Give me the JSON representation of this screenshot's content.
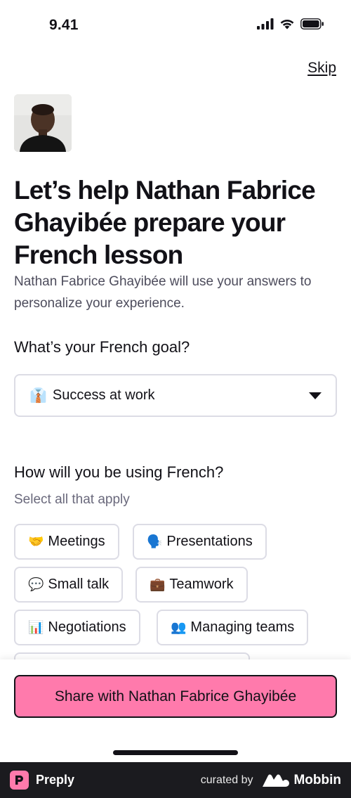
{
  "status_bar": {
    "time": "9.41"
  },
  "header": {
    "skip_label": "Skip"
  },
  "headline": "Let’s help Nathan Fabrice Ghayibée prepare your French lesson",
  "subtext": "Nathan Fabrice Ghayibée will use your answers to personalize your experience.",
  "goal": {
    "question": "What’s your French goal?",
    "selected_emoji": "👔",
    "selected_label": "Success at work"
  },
  "usage": {
    "question": "How will you be using French?",
    "hint": "Select all that apply",
    "options": [
      {
        "emoji": "🤝",
        "label": "Meetings"
      },
      {
        "emoji": "🗣️",
        "label": "Presentations"
      },
      {
        "emoji": "💬",
        "label": "Small talk"
      },
      {
        "emoji": "💼",
        "label": "Teamwork"
      },
      {
        "emoji": "📊",
        "label": "Negotiations"
      },
      {
        "emoji": "👥",
        "label": "Managing teams"
      }
    ]
  },
  "cta": {
    "label": "Share with Nathan Fabrice Ghayibée"
  },
  "footer": {
    "brand": "Preply",
    "curated_by": "curated by",
    "curator": "Mobbin"
  },
  "colors": {
    "accent_pink": "#ff7aac",
    "text_dark": "#121117",
    "border_gray": "#dcdce5",
    "footer_bg": "#1b1b1f"
  }
}
